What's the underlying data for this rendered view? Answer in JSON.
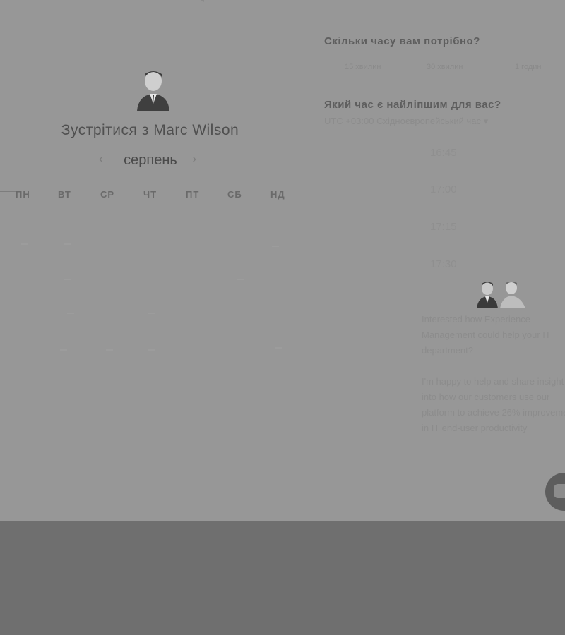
{
  "scheduler": {
    "title": "Зустрітися з Marc Wilson",
    "month": "серпень",
    "prev_icon": "‹",
    "next_icon": "›",
    "weekdays": [
      "ПН",
      "ВТ",
      "СР",
      "ЧТ",
      "ПТ",
      "СБ",
      "НД"
    ]
  },
  "duration": {
    "question": "Скільки часу вам потрібно?",
    "options": [
      "15 хвилин",
      "30 хвилин",
      "1 годин"
    ]
  },
  "time": {
    "question": "Який час є найліпшим для вас?",
    "timezone": "UTC +03:00 Східноєвропейський час",
    "timezone_caret": "▾",
    "slots": [
      "16:45",
      "17:00",
      "17:15",
      "17:30"
    ]
  },
  "chat": {
    "message_1": "Interested how Experience Management could help your IT department?",
    "message_2": "I'm happy to help and share insight into how our customers use our platform to achieve 26% improvement in IT end-user productivity"
  },
  "colors": {
    "overlay_bg": "#979797",
    "bottom_bg": "#6f6f6f"
  }
}
